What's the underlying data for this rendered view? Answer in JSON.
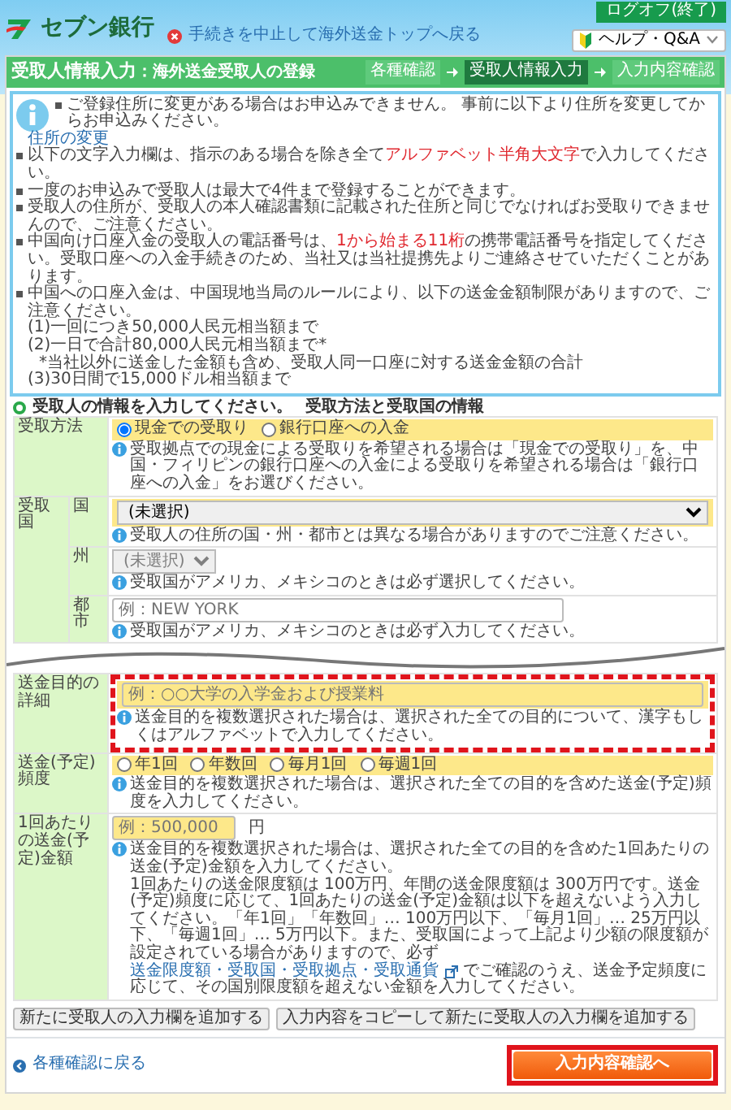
{
  "header": {
    "logo_text": "セブン銀行",
    "cancel_link": "手続きを中止して海外送金トップへ戻る",
    "logout_button": "ログオフ(終了)",
    "help_menu": "ヘルプ・Q&A"
  },
  "page_title": {
    "title": "受取人情報入力",
    "subtitle": "：海外送金受取人の登録"
  },
  "steps": [
    {
      "label": "各種確認",
      "selected": false
    },
    {
      "label": "受取人情報入力",
      "selected": true
    },
    {
      "label": "入力内容確認",
      "selected": false
    }
  ],
  "notices": [
    {
      "kind": "bullet",
      "parts": [
        {
          "text": "ご登録住所に変更がある場合はお申込みできません。 事前に以下より住所を変更してからお申込みください。",
          "emphasis": false
        }
      ]
    },
    {
      "kind": "link",
      "text": "住所の変更"
    },
    {
      "kind": "bullet",
      "parts": [
        {
          "text": "以下の文字入力欄は、指示のある場合を除き全て",
          "emphasis": false
        },
        {
          "text": "アルファベット半角大文字",
          "emphasis": true
        },
        {
          "text": "で入力してください。",
          "emphasis": false
        }
      ]
    },
    {
      "kind": "bullet",
      "parts": [
        {
          "text": "一度のお申込みで受取人は最大で4件まで登録することができます。",
          "emphasis": false
        }
      ]
    },
    {
      "kind": "bullet",
      "parts": [
        {
          "text": "受取人の住所が、受取人の本人確認書類に記載された住所と同じでなければお受取りできませんので、ご注意ください。",
          "emphasis": false
        }
      ]
    },
    {
      "kind": "bullet",
      "parts": [
        {
          "text": "中国向け口座入金の受取人の電話番号は、",
          "emphasis": false
        },
        {
          "text": "1から始まる11桁",
          "emphasis": true
        },
        {
          "text": "の携帯電話番号を指定してください。受取口座への入金手続きのため、当社又は当社提携先よりご連絡させていただくことがあります。",
          "emphasis": false
        }
      ]
    },
    {
      "kind": "bullet",
      "parts": [
        {
          "text": "中国への口座入金は、中国現地当局のルールにより、以下の送金金額制限がありますので、ご注意ください。",
          "emphasis": false
        }
      ]
    },
    {
      "kind": "sub",
      "text": "(1)一回につき50,000人民元相当額まで"
    },
    {
      "kind": "sub",
      "text": "(2)一日で合計80,000人民元相当額まで*"
    },
    {
      "kind": "footnote",
      "text": "*当社以外に送金した金額も含め、受取人同一口座に対する送金金額の合計"
    },
    {
      "kind": "sub",
      "text": "(3)30日間で15,000ドル相当額まで"
    }
  ],
  "instruction": "受取人の情報を入力してください。",
  "section_title": "受取方法と受取国の情報",
  "form_parts": [
    {
      "rows": [
        {
          "kind": "radios",
          "label": "受取方法",
          "required": true,
          "options": [
            {
              "label": "現金での受取り",
              "selected": true
            },
            {
              "label": "銀行口座への入金",
              "selected": false
            }
          ],
          "note": "受取拠点での現金による受取りを希望される場合は「現金での受取り」を、中国・フィリピンの銀行口座への入金による受取りを希望される場合は「銀行口座への入金」をお選びください。"
        },
        {
          "kind": "group",
          "label": "受取国",
          "children": [
            {
              "kind": "select",
              "label": "国",
              "required": true,
              "disabled": false,
              "value": "(未選択)",
              "note": "受取人の住所の国・州・都市とは異なる場合がありますのでご注意ください。"
            },
            {
              "kind": "select",
              "label": "州",
              "required": false,
              "disabled": true,
              "value": "(未選択)",
              "note": "受取国がアメリカ、メキシコのときは必ず選択してください。"
            },
            {
              "kind": "text",
              "label": "都市",
              "required": false,
              "placeholder": "例：NEW YORK",
              "note": "受取国がアメリカ、メキシコのときは必ず入力してください。"
            }
          ]
        }
      ]
    },
    {
      "rows": [
        {
          "kind": "text",
          "label": "送金目的の詳細",
          "required": true,
          "highlighted": true,
          "placeholder": "例：○○大学の入学金および授業料",
          "note": "送金目的を複数選択された場合は、選択された全ての目的について、漢字もしくはアルファベットで入力してください。"
        },
        {
          "kind": "radios",
          "label": "送金(予定)頻度",
          "required": true,
          "options": [
            {
              "label": "年1回",
              "selected": false
            },
            {
              "label": "年数回",
              "selected": false
            },
            {
              "label": "毎月1回",
              "selected": false
            },
            {
              "label": "毎週1回",
              "selected": false
            }
          ],
          "note": "送金目的を複数選択された場合は、選択された全ての目的を含めた送金(予定)頻度を入力してください。"
        },
        {
          "kind": "amount",
          "label": "1回あたりの送金(予定)金額",
          "required": true,
          "placeholder": "例：500,000",
          "unit": "円",
          "note": "送金目的を複数選択された場合は、選択された全ての目的を含めた1回あたりの送金(予定)金額を入力してください。",
          "detail": [
            {
              "text": "1回あたりの送金限度額は 100万円、年間の送金限度額は 300万円です。送金(予定)頻度に応じて、1回あたりの送金(予定)金額は以下を超えないよう入力してください。「年1回」「年数回」… 100万円以下、「毎月1回」… 25万円以下、「毎週1回」… 5万円以下。また、受取国によって上記より少額の限度額が設定されている場合がありますので、必ず ",
              "link": false
            },
            {
              "text": "送金限度額・受取国・受取拠点・受取通貨",
              "link": true
            },
            {
              "text": " でご確認のうえ、送金予定頻度に応じて、その国別限度額を超えない金額を入力してください。",
              "link": false
            }
          ]
        }
      ]
    }
  ],
  "add_buttons": [
    "新たに受取人の入力欄を追加する",
    "入力内容をコピーして新たに受取人の入力欄を追加する"
  ],
  "back_link": "各種確認に戻る",
  "confirm_button": {
    "label": "入力内容確認へ",
    "highlighted": true
  }
}
